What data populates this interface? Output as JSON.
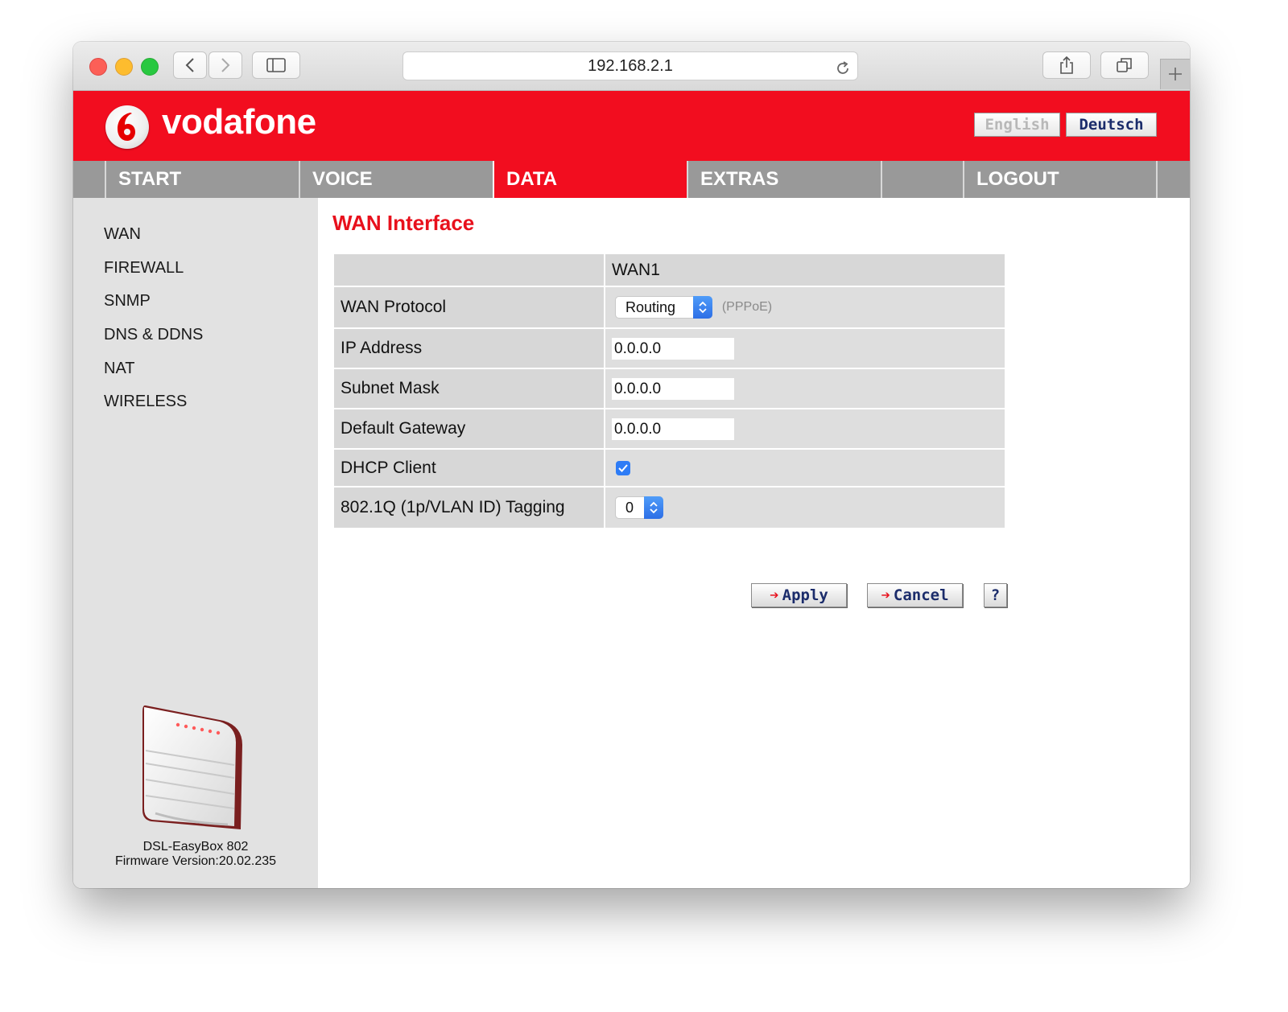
{
  "browser": {
    "url": "192.168.2.1"
  },
  "header": {
    "brand": "vodafone",
    "lang_english": "English",
    "lang_deutsch": "Deutsch"
  },
  "nav": {
    "items": [
      {
        "label": "START"
      },
      {
        "label": "VOICE"
      },
      {
        "label": "DATA"
      },
      {
        "label": "EXTRAS"
      },
      {
        "label": ""
      },
      {
        "label": "LOGOUT"
      }
    ],
    "active": "DATA"
  },
  "sidebar": {
    "items": [
      {
        "label": "WAN"
      },
      {
        "label": "FIREWALL"
      },
      {
        "label": "SNMP"
      },
      {
        "label": "DNS & DDNS"
      },
      {
        "label": "NAT"
      },
      {
        "label": "WIRELESS"
      }
    ],
    "device_name": "DSL-EasyBox 802",
    "firmware": "Firmware Version:20.02.235"
  },
  "main": {
    "title": "WAN Interface",
    "table": {
      "column_header": "WAN1",
      "rows": {
        "protocol_label": "WAN Protocol",
        "protocol_value": "Routing",
        "protocol_hint": "(PPPoE)",
        "ip_label": "IP Address",
        "ip_value": "0.0.0.0",
        "subnet_label": "Subnet Mask",
        "subnet_value": "0.0.0.0",
        "gateway_label": "Default Gateway",
        "gateway_value": "0.0.0.0",
        "dhcp_label": "DHCP Client",
        "dhcp_checked": true,
        "vlan_label": "802.1Q (1p/VLAN ID) Tagging",
        "vlan_value": "0"
      }
    },
    "buttons": {
      "apply": "Apply",
      "cancel": "Cancel",
      "help": "?"
    }
  },
  "colors": {
    "brand_red": "#f20d1f",
    "nav_gray": "#999999",
    "title_red": "#e8101c",
    "button_text": "#1b2c6b"
  }
}
